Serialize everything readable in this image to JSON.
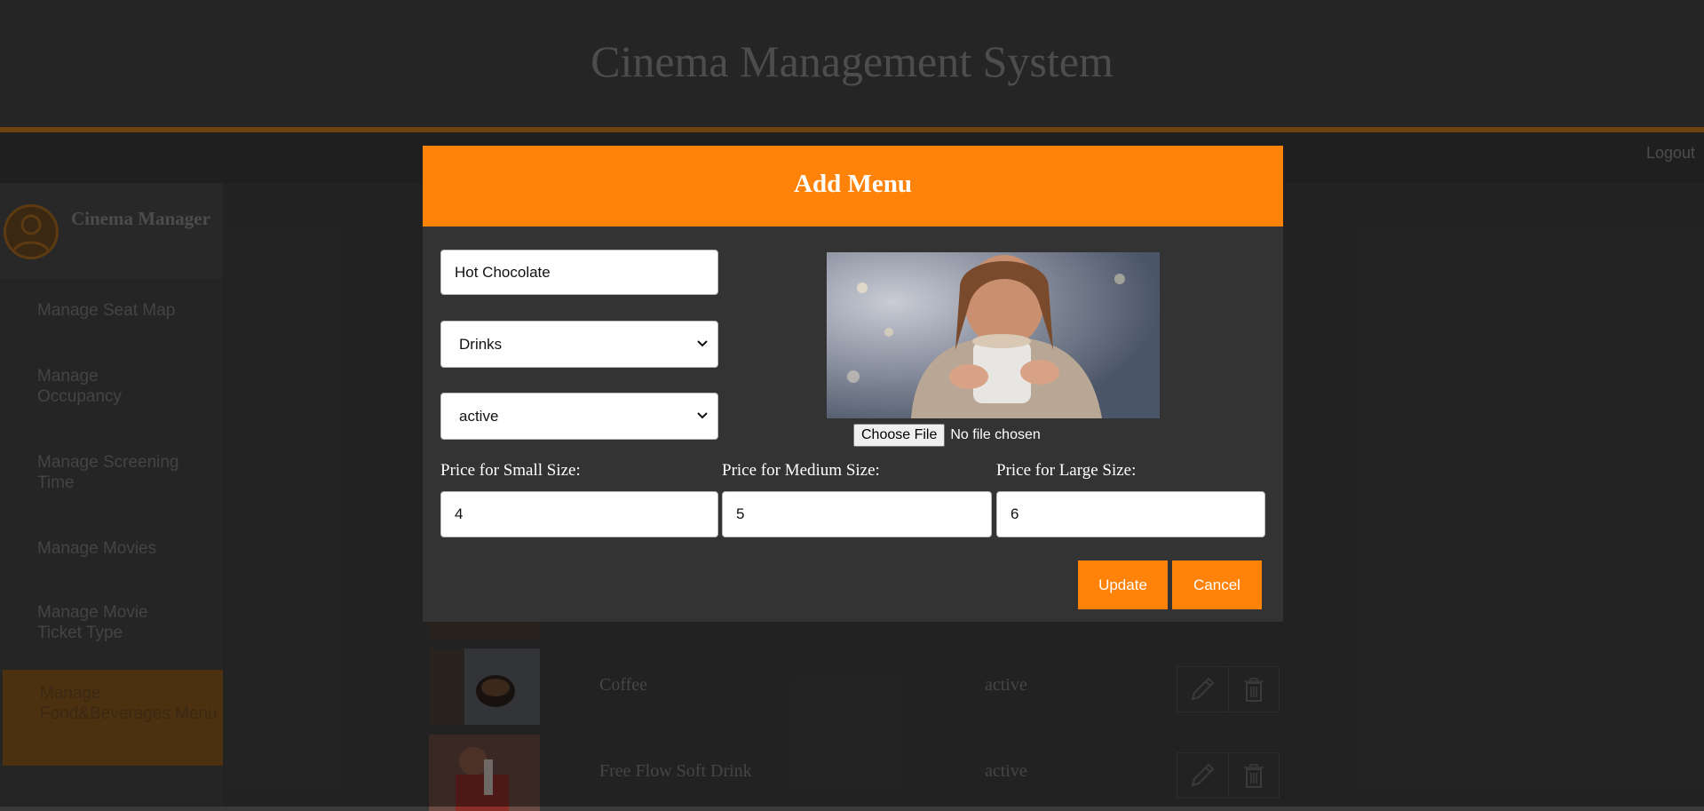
{
  "header": {
    "title": "Cinema Management System",
    "logout_label": "Logout"
  },
  "sidebar": {
    "profile_name": "Cinema Manager",
    "items": [
      {
        "label": "Manage Seat Map"
      },
      {
        "label": "Manage Occupancy"
      },
      {
        "label": "Manage Screening Time"
      },
      {
        "label": "Manage Movies"
      },
      {
        "label": "Manage Movie Ticket Type"
      },
      {
        "label": "Manage Food&Beverages Menu"
      }
    ]
  },
  "menu_list": {
    "rows": [
      {
        "name": "Coffee",
        "status": "active"
      },
      {
        "name": "Free Flow Soft Drink",
        "status": "active"
      }
    ]
  },
  "modal": {
    "title": "Add Menu",
    "name_value": "Hot Chocolate",
    "category_value": "Drinks",
    "status_value": "active",
    "file_button_label": "Choose File",
    "file_status": "No file chosen",
    "price_small_label": "Price for Small Size:",
    "price_medium_label": "Price for Medium Size:",
    "price_large_label": "Price for Large Size:",
    "price_small_value": "4",
    "price_medium_value": "5",
    "price_large_value": "6",
    "update_label": "Update",
    "cancel_label": "Cancel"
  },
  "colors": {
    "accent": "#ff8309",
    "modal_bg": "#333333"
  },
  "icons": {
    "edit": "pencil-icon",
    "delete": "trash-icon",
    "avatar": "user-icon"
  }
}
